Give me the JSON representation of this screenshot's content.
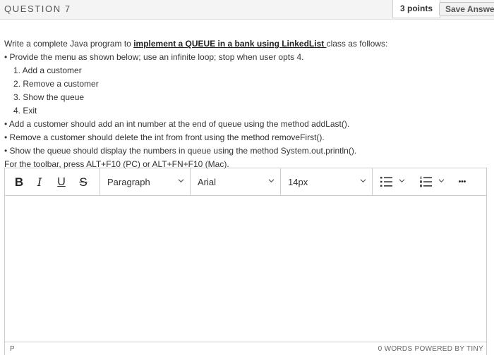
{
  "question": {
    "title": "QUESTION 7",
    "points": "3 points",
    "save_label": "Save Answer"
  },
  "prompt": {
    "intro_before": "Write a complete Java program to ",
    "intro_bold": "implement a QUEUE in a bank using LinkedList ",
    "intro_after": " class as follows:",
    "bullet_menu": "• Provide the menu as shown below; use an infinite loop; stop when user opts 4.",
    "menu_items": [
      "1. Add a customer",
      "2. Remove a customer",
      "3. Show the queue",
      "4. Exit"
    ],
    "bullet_add": "• Add a customer should add an int number at the end of queue using the method addLast().",
    "bullet_remove": "• Remove a customer should delete the int from front using the method removeFirst().",
    "bullet_show": "• Show the queue should display the numbers in queue using the method System.out.println().",
    "toolbar_hint": "For the toolbar, press ALT+F10 (PC) or ALT+FN+F10 (Mac)."
  },
  "editor": {
    "bold_label": "B",
    "italic_label": "I",
    "underline_label": "U",
    "strike_label": "S",
    "block_format": "Paragraph",
    "font_family": "Arial",
    "font_size": "14px",
    "more_label": "•••",
    "icons": [
      "bulleted-list-icon",
      "numbered-list-icon",
      "chevron-down-icon",
      "more-icon"
    ],
    "content": "",
    "status_path": "P",
    "status_right": "0 WORDS  POWERED BY TINY"
  }
}
